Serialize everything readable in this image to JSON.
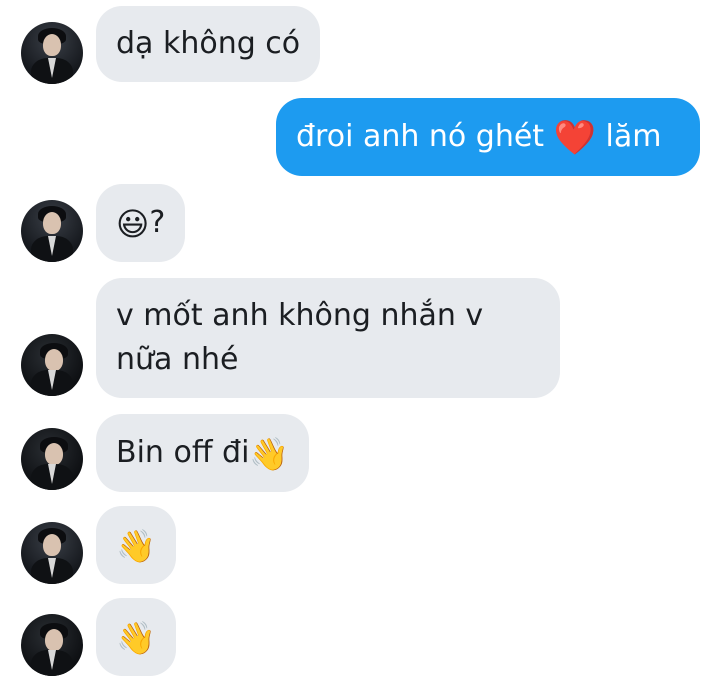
{
  "conversation": {
    "messages": [
      {
        "sender": "them",
        "text": "dạ không có"
      },
      {
        "sender": "me",
        "text_before": "đroi anh nó ghét ",
        "emoji": "❤️",
        "text_after": " lăm"
      },
      {
        "sender": "them",
        "emoji": "😃",
        "text_after": "?"
      },
      {
        "sender": "them",
        "lines": [
          "v mốt anh không nhắn v",
          "nữa nhé"
        ]
      },
      {
        "sender": "them",
        "text": "Bin off đi",
        "emoji": "👋"
      },
      {
        "sender": "them",
        "emoji": "👋"
      },
      {
        "sender": "them",
        "emoji": "👋"
      }
    ]
  },
  "colors": {
    "sent_bubble": "#1d9bf0",
    "received_bubble": "#e7eaee",
    "received_text": "#1b1e22",
    "heart": "#e0245e"
  }
}
